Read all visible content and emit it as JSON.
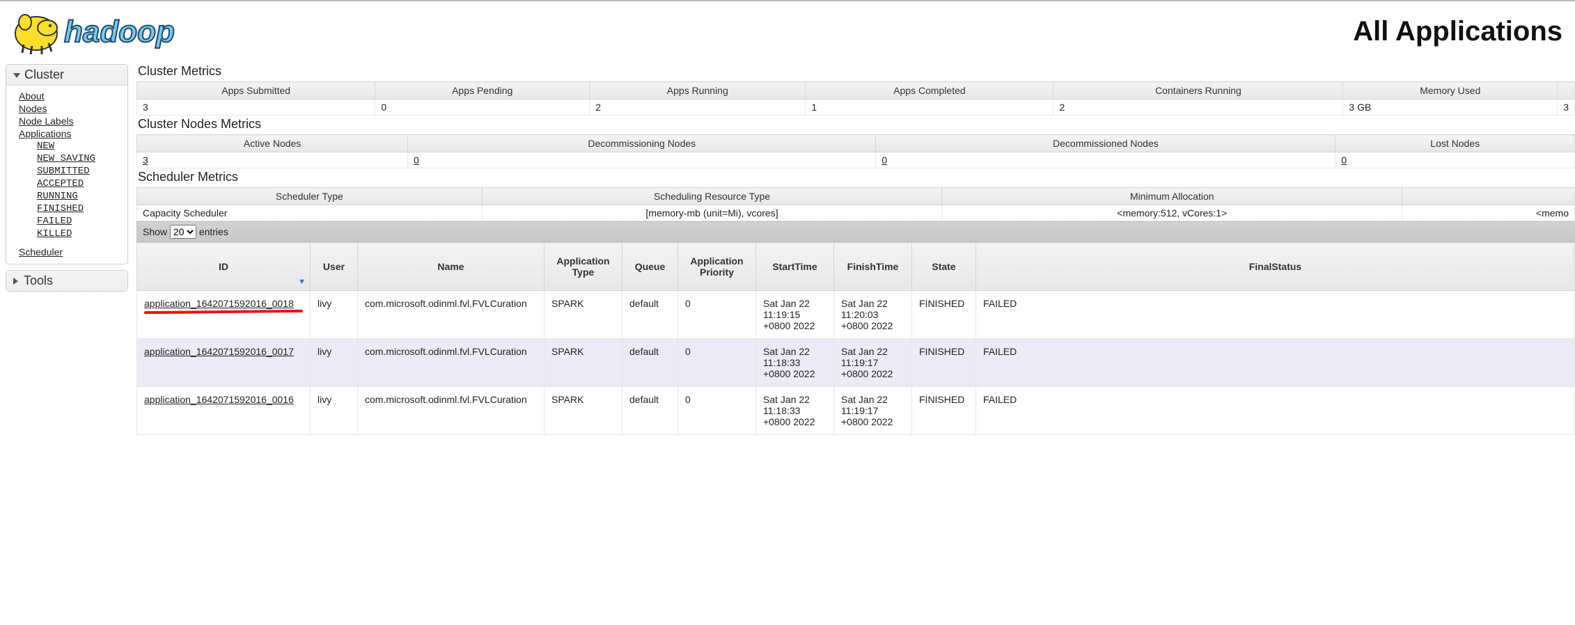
{
  "header": {
    "page_title": "All Applications",
    "logo_alt": "hadoop"
  },
  "sidebar": {
    "cluster": {
      "title": "Cluster",
      "links": [
        "About",
        "Nodes",
        "Node Labels",
        "Applications"
      ],
      "app_states": [
        "NEW",
        "NEW_SAVING",
        "SUBMITTED",
        "ACCEPTED",
        "RUNNING",
        "FINISHED",
        "FAILED",
        "KILLED"
      ],
      "scheduler": "Scheduler"
    },
    "tools": {
      "title": "Tools"
    }
  },
  "sections": {
    "cluster_metrics": "Cluster Metrics",
    "cluster_nodes_metrics": "Cluster Nodes Metrics",
    "scheduler_metrics": "Scheduler Metrics"
  },
  "cluster_metrics": {
    "headers": [
      "Apps Submitted",
      "Apps Pending",
      "Apps Running",
      "Apps Completed",
      "Containers Running",
      "Memory Used"
    ],
    "values": [
      "3",
      "0",
      "2",
      "1",
      "2",
      "3 GB"
    ],
    "trailing": "3"
  },
  "nodes_metrics": {
    "headers": [
      "Active Nodes",
      "Decommissioning Nodes",
      "Decommissioned Nodes",
      "Lost Nodes"
    ],
    "values": [
      "3",
      "0",
      "0",
      "0"
    ]
  },
  "scheduler_metrics": {
    "headers": [
      "Scheduler Type",
      "Scheduling Resource Type",
      "Minimum Allocation",
      ""
    ],
    "values": [
      "Capacity Scheduler",
      "[memory-mb (unit=Mi), vcores]",
      "<memory:512, vCores:1>",
      "<memo"
    ]
  },
  "datatable": {
    "show_label_pre": "Show",
    "show_label_post": "entries",
    "show_value": "20",
    "columns": [
      "ID",
      "User",
      "Name",
      "Application Type",
      "Queue",
      "Application Priority",
      "StartTime",
      "FinishTime",
      "State",
      "FinalStatus"
    ],
    "rows": [
      {
        "id": "application_1642071592016_0018",
        "user": "livy",
        "name": "com.microsoft.odinml.fvl.FVLCuration",
        "type": "SPARK",
        "queue": "default",
        "priority": "0",
        "start": "Sat Jan 22 11:19:15 +0800 2022",
        "finish": "Sat Jan 22 11:20:03 +0800 2022",
        "state": "FINISHED",
        "final": "FAILED",
        "annotated": true
      },
      {
        "id": "application_1642071592016_0017",
        "user": "livy",
        "name": "com.microsoft.odinml.fvl.FVLCuration",
        "type": "SPARK",
        "queue": "default",
        "priority": "0",
        "start": "Sat Jan 22 11:18:33 +0800 2022",
        "finish": "Sat Jan 22 11:19:17 +0800 2022",
        "state": "FINISHED",
        "final": "FAILED"
      },
      {
        "id": "application_1642071592016_0016",
        "user": "livy",
        "name": "com.microsoft.odinml.fvl.FVLCuration",
        "type": "SPARK",
        "queue": "default",
        "priority": "0",
        "start": "Sat Jan 22 11:18:33 +0800 2022",
        "finish": "Sat Jan 22 11:19:17 +0800 2022",
        "state": "FINISHED",
        "final": "FAILED"
      }
    ]
  }
}
